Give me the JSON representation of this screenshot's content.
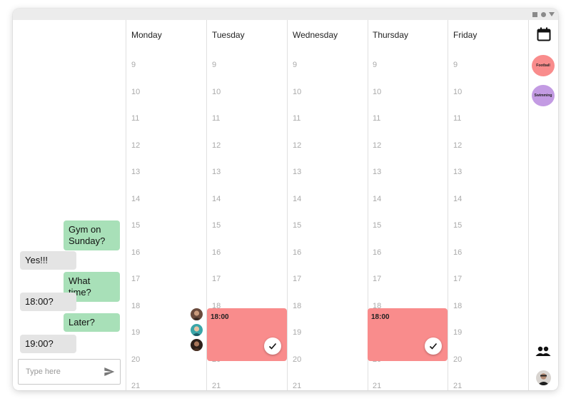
{
  "chat": {
    "messages": [
      {
        "from": "me",
        "text": "Gym on Sunday?"
      },
      {
        "from": "them",
        "text": "Yes!!!"
      },
      {
        "from": "me",
        "text": "What time?"
      },
      {
        "from": "them",
        "text": "18:00?"
      },
      {
        "from": "me",
        "text": "Later?"
      },
      {
        "from": "them",
        "text": "19:00?"
      }
    ],
    "input": {
      "placeholder": "Type here",
      "value": ""
    }
  },
  "calendar": {
    "days": [
      "Monday",
      "Tuesday",
      "Wednesday",
      "Thursday",
      "Friday"
    ],
    "hours": [
      "9",
      "10",
      "11",
      "12",
      "13",
      "14",
      "15",
      "16",
      "17",
      "18",
      "19",
      "20",
      "21"
    ],
    "events": [
      {
        "day": "Tuesday",
        "time": "18:00",
        "color": "#f98c8c",
        "confirmed": true
      },
      {
        "day": "Thursday",
        "time": "18:00",
        "color": "#f98c8c",
        "confirmed": true
      }
    ]
  },
  "sidebar": {
    "tags": [
      {
        "label": "Football",
        "color": "#f98c8c"
      },
      {
        "label": "Swimming",
        "color": "#c39be3"
      }
    ],
    "icons": [
      "calendar-icon",
      "people-icon",
      "user-avatar"
    ]
  },
  "colors": {
    "my_bubble": "#a8e0b8",
    "their_bubble": "#e4e4e4",
    "event": "#f98c8c"
  }
}
